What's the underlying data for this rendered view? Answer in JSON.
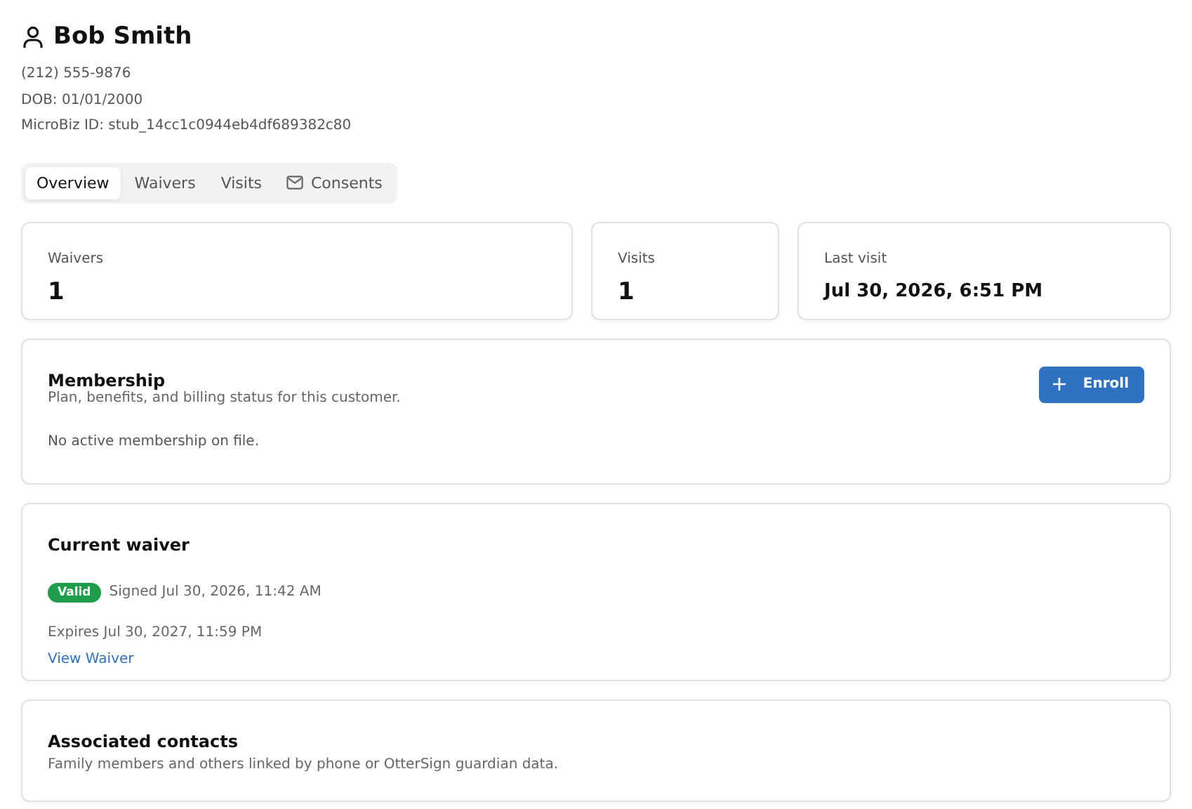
{
  "customer": {
    "name": "Bob Smith",
    "details": [
      "(212) 555-9876",
      "DOB: 01/01/2000",
      "MicroBiz ID: stub_14cc1c0944eb4df689382c80"
    ]
  },
  "tabs": [
    {
      "label": "Overview",
      "selected": true,
      "kind": "plain"
    },
    {
      "label": "Waivers",
      "selected": false,
      "kind": "plain"
    },
    {
      "label": "Visits",
      "selected": false,
      "kind": "plain"
    },
    {
      "label": "Consents",
      "selected": false,
      "kind": "mail"
    }
  ],
  "stats": [
    {
      "label": "Waivers",
      "value": "1",
      "kind": "count"
    },
    {
      "label": "Visits",
      "value": "1",
      "kind": "count"
    },
    {
      "label": "Last visit",
      "value": "Jul 30, 2026, 6:51 PM",
      "kind": "date"
    }
  ],
  "membership": {
    "title": "Membership",
    "subtitle": "Plan, benefits, and billing status for this customer.",
    "button": "Enroll",
    "empty": "No active membership on file."
  },
  "current_waiver": {
    "title": "Current waiver",
    "status": {
      "label": "Valid",
      "color": "#1f9d4c"
    },
    "signed": "Signed Jul 30, 2026, 11:42 AM",
    "expires": "Expires Jul 30, 2027, 11:59 PM",
    "link": "View Waiver"
  },
  "associated_contacts": {
    "title": "Associated contacts",
    "subtitle": "Family members and others linked by phone or OtterSign guardian data."
  }
}
